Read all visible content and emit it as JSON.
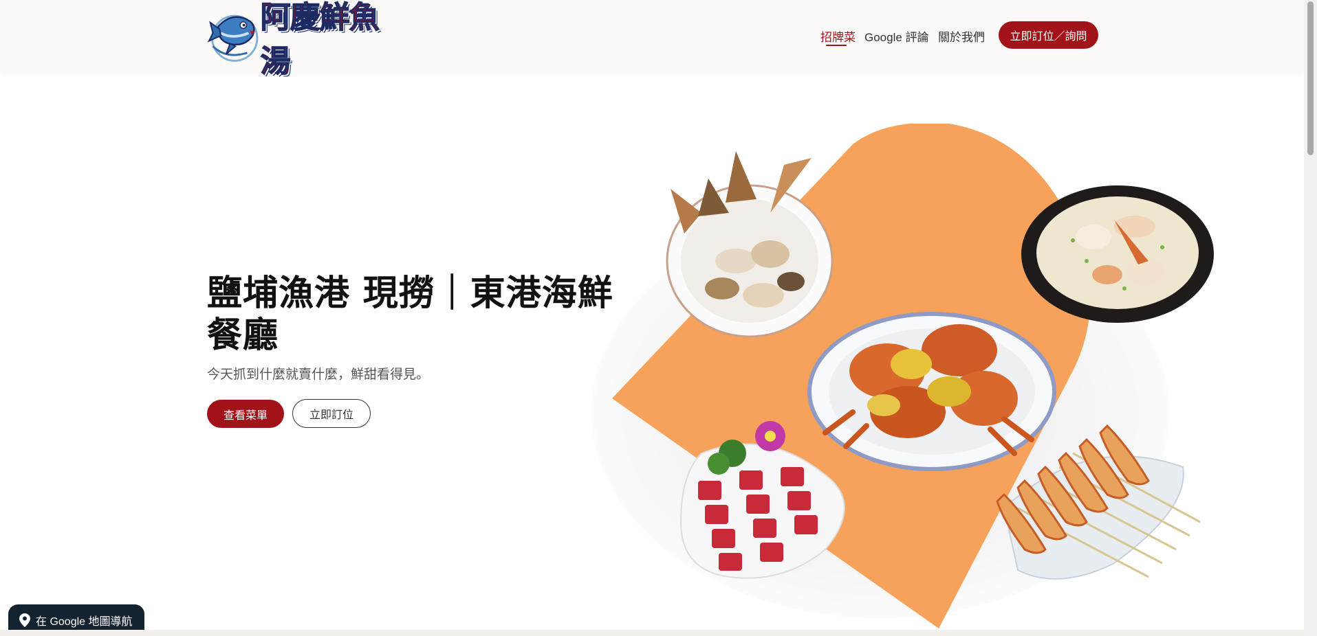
{
  "header": {
    "logo_text": "阿慶鮮魚湯",
    "logo_icon": "fish-mascot-icon",
    "nav": [
      {
        "label": "招牌菜",
        "active": true
      },
      {
        "label": "Google 評論",
        "active": false
      },
      {
        "label": "關於我們",
        "active": false
      }
    ],
    "cta_label": "立即訂位／詢問"
  },
  "hero": {
    "title": "鹽埔漁港 現撈｜東港海鮮餐廳",
    "subtitle": "今天抓到什麼就賣什麼，鮮甜看得見。",
    "primary_button": "查看菜單",
    "secondary_button": "立即訂位"
  },
  "floating": {
    "maps_label": "在 Google 地圖導航",
    "maps_icon": "map-pin-icon"
  },
  "colors": {
    "brand_red": "#a11219",
    "accent_orange": "#f7a25a",
    "header_bg": "#fbfaf8",
    "dark_button": "#142330"
  }
}
